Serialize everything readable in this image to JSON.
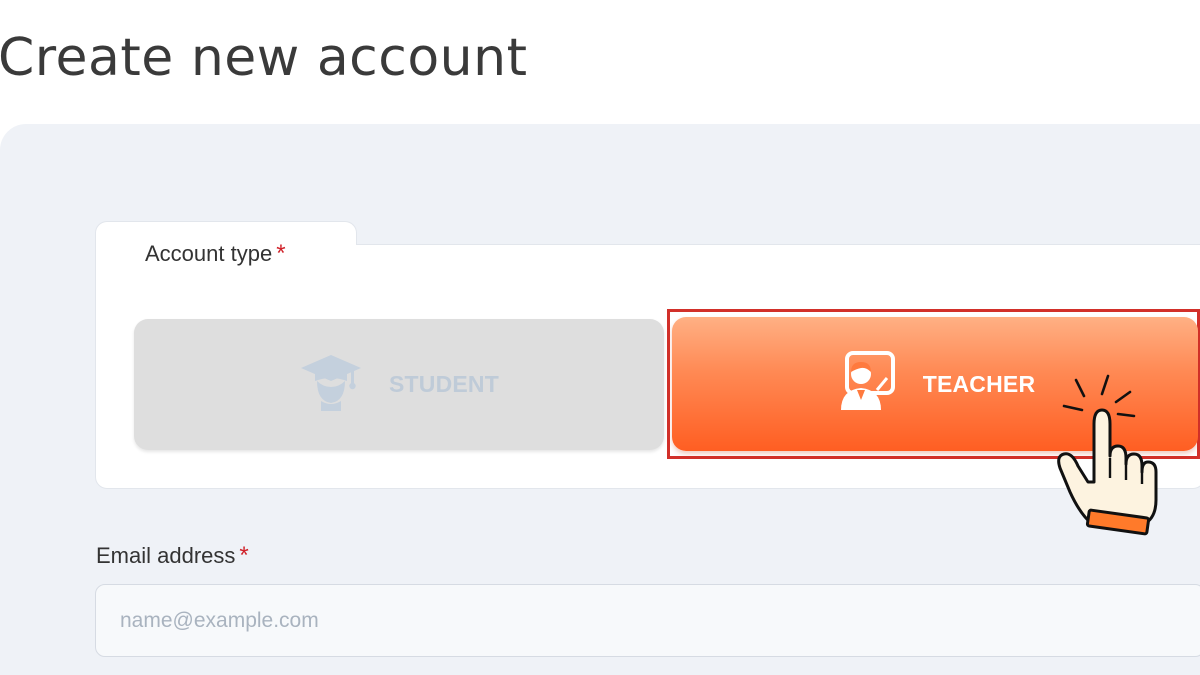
{
  "page": {
    "title": "Create new account"
  },
  "account_type": {
    "label": "Account type",
    "required_mark": "*",
    "options": [
      {
        "label": "STUDENT",
        "icon": "graduation-cap-icon",
        "selected": false
      },
      {
        "label": "TEACHER",
        "icon": "teacher-board-icon",
        "selected": true
      }
    ]
  },
  "email": {
    "label": "Email address",
    "required_mark": "*",
    "value": "",
    "placeholder": "name@example.com"
  },
  "colors": {
    "accent": "#ff6a30",
    "highlight_border": "#d2302a",
    "required": "#d0222a"
  }
}
